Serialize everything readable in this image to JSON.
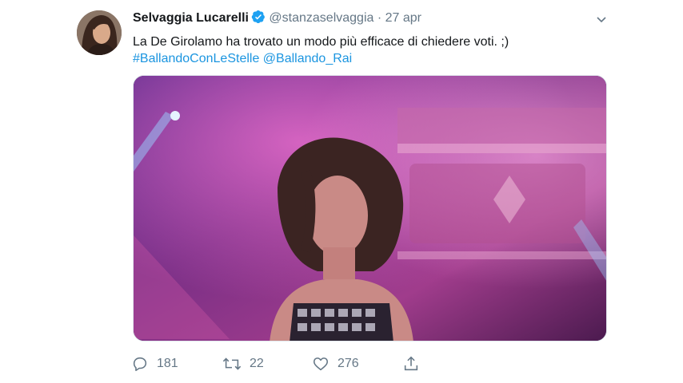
{
  "tweet": {
    "author_name": "Selvaggia Lucarelli",
    "handle": "@stanzaselvaggia",
    "separator": "·",
    "date": "27 apr",
    "text": "La De Girolamo ha trovato un modo più efficace di chiedere voti. ;)",
    "hashtag": "#BallandoConLeStelle",
    "mention": "@Ballando_Rai"
  },
  "actions": {
    "replies": "181",
    "retweets": "22",
    "likes": "276"
  },
  "icons": {
    "verified": "verified-badge-icon",
    "menu": "chevron-down-icon",
    "reply": "reply-icon",
    "retweet": "retweet-icon",
    "like": "heart-icon",
    "share": "share-icon"
  },
  "colors": {
    "link": "#1b95e0",
    "secondary_text": "#657786",
    "verified": "#1da1f2"
  }
}
